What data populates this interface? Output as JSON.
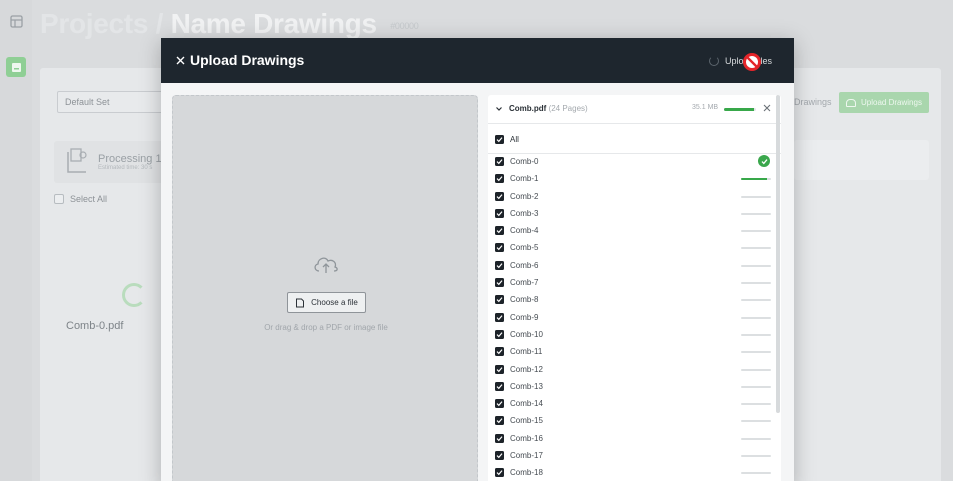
{
  "background": {
    "breadcrumb": {
      "parent": "Projects",
      "separator": "/",
      "current": "Name Drawings",
      "project_id": "#00000"
    },
    "set_select": {
      "value": "Default Set"
    },
    "processing": {
      "title": "Processing 1 /",
      "subtitle": "Estimated time: 30 s"
    },
    "select_all_label": "Select All",
    "file_card_label": "Comb-0.pdf",
    "drawings_link": "Drawings",
    "upload_button_label": "Upload Drawings"
  },
  "modal": {
    "title": "Upload Drawings",
    "upload_files_label": "Upload files",
    "dropzone": {
      "choose_button_label": "Choose a file",
      "hint": "Or drag & drop a PDF or image file"
    },
    "file": {
      "name": "Comb.pdf",
      "pages": "(24 Pages)",
      "size": "35.1 MB",
      "upload_progress": 0.95,
      "all_label": "All",
      "pages_list": [
        {
          "label": "Comb-0",
          "checked": true,
          "status": "done",
          "progress": 1
        },
        {
          "label": "Comb-1",
          "checked": true,
          "status": "uploading",
          "progress": 0.85
        },
        {
          "label": "Comb-2",
          "checked": true,
          "status": "pending",
          "progress": 0
        },
        {
          "label": "Comb-3",
          "checked": true,
          "status": "pending",
          "progress": 0
        },
        {
          "label": "Comb-4",
          "checked": true,
          "status": "pending",
          "progress": 0
        },
        {
          "label": "Comb-5",
          "checked": true,
          "status": "pending",
          "progress": 0
        },
        {
          "label": "Comb-6",
          "checked": true,
          "status": "pending",
          "progress": 0
        },
        {
          "label": "Comb-7",
          "checked": true,
          "status": "pending",
          "progress": 0
        },
        {
          "label": "Comb-8",
          "checked": true,
          "status": "pending",
          "progress": 0
        },
        {
          "label": "Comb-9",
          "checked": true,
          "status": "pending",
          "progress": 0
        },
        {
          "label": "Comb-10",
          "checked": true,
          "status": "pending",
          "progress": 0
        },
        {
          "label": "Comb-11",
          "checked": true,
          "status": "pending",
          "progress": 0
        },
        {
          "label": "Comb-12",
          "checked": true,
          "status": "pending",
          "progress": 0
        },
        {
          "label": "Comb-13",
          "checked": true,
          "status": "pending",
          "progress": 0
        },
        {
          "label": "Comb-14",
          "checked": true,
          "status": "pending",
          "progress": 0
        },
        {
          "label": "Comb-15",
          "checked": true,
          "status": "pending",
          "progress": 0
        },
        {
          "label": "Comb-16",
          "checked": true,
          "status": "pending",
          "progress": 0
        },
        {
          "label": "Comb-17",
          "checked": true,
          "status": "pending",
          "progress": 0
        },
        {
          "label": "Comb-18",
          "checked": true,
          "status": "pending",
          "progress": 0
        }
      ]
    }
  },
  "colors": {
    "header": "#1e262e",
    "accent": "#38a84a",
    "checkbox": "#1d2329"
  },
  "icons": [
    "app-grid-icon",
    "drawings-icon",
    "close-icon",
    "loader-icon",
    "no-entry-icon",
    "cloud-upload-icon",
    "document-icon",
    "chevron-down-icon",
    "check-icon",
    "check-circle-icon",
    "spinner-icon"
  ]
}
